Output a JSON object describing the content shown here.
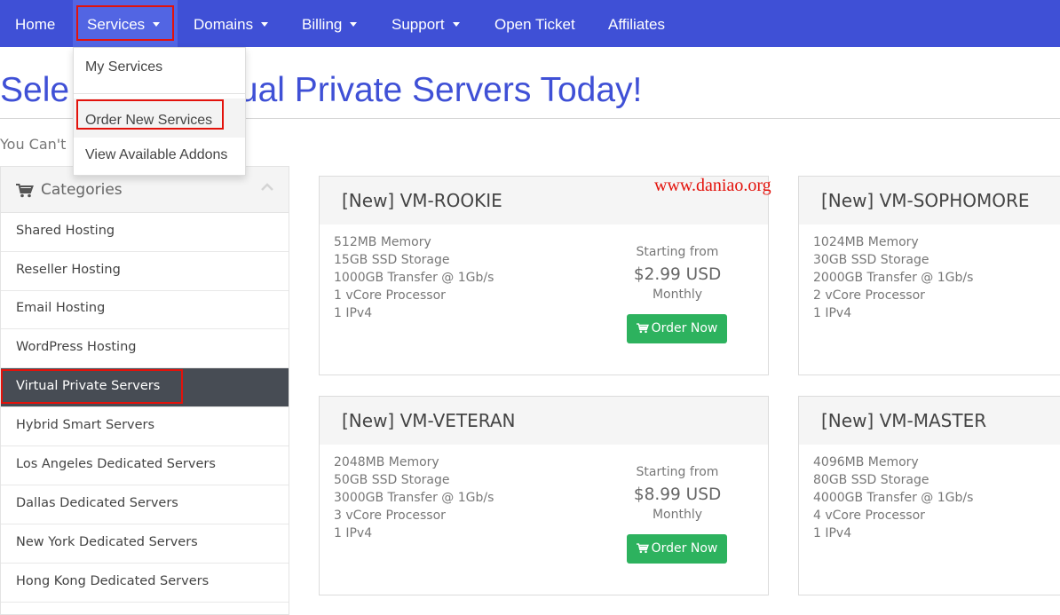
{
  "nav": {
    "home": "Home",
    "services": "Services",
    "domains": "Domains",
    "billing": "Billing",
    "support": "Support",
    "open_ticket": "Open Ticket",
    "affiliates": "Affiliates",
    "accent_color": "#3f50d6"
  },
  "services_dropdown": {
    "my_services": "My Services",
    "order_new_services": "Order New Services",
    "view_available_addons": "View Available Addons"
  },
  "headline": {
    "left": "Sele",
    "right": "tual Private Servers Today!"
  },
  "tagline": "You Can't",
  "sidebar": {
    "title": "Categories",
    "items": [
      {
        "label": "Shared Hosting"
      },
      {
        "label": "Reseller Hosting"
      },
      {
        "label": "Email Hosting"
      },
      {
        "label": "WordPress Hosting"
      },
      {
        "label": "Virtual Private Servers",
        "active": true
      },
      {
        "label": "Hybrid Smart Servers"
      },
      {
        "label": "Los Angeles Dedicated Servers"
      },
      {
        "label": "Dallas Dedicated Servers"
      },
      {
        "label": "New York Dedicated Servers"
      },
      {
        "label": "Hong Kong Dedicated Servers"
      }
    ]
  },
  "products": [
    {
      "title": "[New] VM-ROOKIE",
      "features": [
        "512MB Memory",
        "15GB SSD Storage",
        "1000GB Transfer @ 1Gb/s",
        "1 vCore Processor",
        "1 IPv4"
      ],
      "starting_from": "Starting from",
      "price": "$2.99 USD",
      "cycle": "Monthly",
      "order_label": "Order Now"
    },
    {
      "title": "[New] VM-SOPHOMORE",
      "features": [
        "1024MB Memory",
        "30GB SSD Storage",
        "2000GB Transfer @ 1Gb/s",
        "2 vCore Processor",
        "1 IPv4"
      ]
    },
    {
      "title": "[New] VM-VETERAN",
      "features": [
        "2048MB Memory",
        "50GB SSD Storage",
        "3000GB Transfer @ 1Gb/s",
        "3 vCore Processor",
        "1 IPv4"
      ],
      "starting_from": "Starting from",
      "price": "$8.99 USD",
      "cycle": "Monthly",
      "order_label": "Order Now"
    },
    {
      "title": "[New] VM-MASTER",
      "features": [
        "4096MB Memory",
        "80GB SSD Storage",
        "4000GB Transfer @ 1Gb/s",
        "4 vCore Processor",
        "1 IPv4"
      ]
    }
  ],
  "watermark": "www.daniao.org",
  "colors": {
    "order_button": "#2db25e",
    "highlight_box": "#e3120b",
    "active_sidebar": "#474c54"
  }
}
